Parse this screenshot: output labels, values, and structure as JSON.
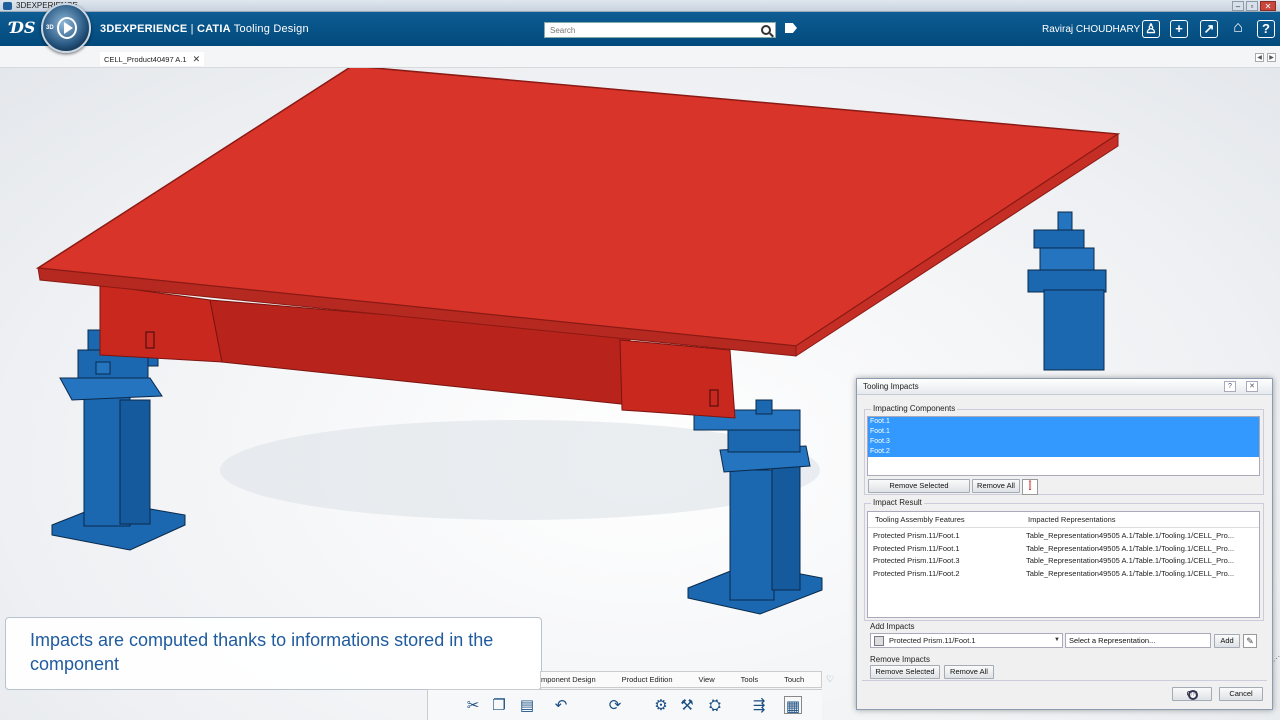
{
  "os_window": {
    "title": "3DEXPERIENCE",
    "controls": [
      "–",
      "▫",
      "✕"
    ]
  },
  "app": {
    "brand": "3DEXPERIENCE",
    "separator": " | ",
    "product": "CATIA",
    "app_name": " Tooling Design",
    "compass_label": "3D",
    "search_placeholder": "Search",
    "user_name": "Raviraj CHOUDHARY",
    "header_buttons": [
      "person-icon",
      "plus-icon",
      "share-icon",
      "home-icon",
      "help-icon"
    ]
  },
  "tabs": {
    "document": "CELL_Product40497 A.1",
    "close_glyph": "✕",
    "nav_left": "◀",
    "nav_right": "▶"
  },
  "caption": {
    "text": "Impacts are computed thanks to informations stored in the component"
  },
  "action_bar": {
    "tabs": [
      "mponent Design",
      "Product Edition",
      "View",
      "Tools",
      "Touch"
    ],
    "more_glyph": "♡",
    "tools": [
      "scissors-icon",
      "copy-icon",
      "paste-icon",
      "undo-icon",
      "update-icon",
      "assembly-icon",
      "tooling-icon",
      "impact-icon",
      "move-icon",
      "table-icon"
    ]
  },
  "dialog": {
    "title": "Tooling Impacts",
    "help_glyph": "?",
    "close_glyph": "✕",
    "impacting_components": {
      "title": "Impacting Components",
      "items": [
        "Foot.1",
        "Foot.1",
        "Foot.3",
        "Foot.2"
      ],
      "remove_selected": "Remove Selected",
      "remove_all": "Remove All"
    },
    "impact_result": {
      "title": "Impact Result",
      "columns": [
        "Tooling Assembly Features",
        "Impacted Representations"
      ],
      "rows": [
        {
          "feature": "Protected Prism.11/Foot.1",
          "representation": "Table_Representation49505 A.1/Table.1/Tooling.1/CELL_Pro..."
        },
        {
          "feature": "Protected Prism.11/Foot.1",
          "representation": "Table_Representation49505 A.1/Table.1/Tooling.1/CELL_Pro..."
        },
        {
          "feature": "Protected Prism.11/Foot.3",
          "representation": "Table_Representation49505 A.1/Table.1/Tooling.1/CELL_Pro..."
        },
        {
          "feature": "Protected Prism.11/Foot.2",
          "representation": "Table_Representation49505 A.1/Table.1/Tooling.1/CELL_Pro..."
        }
      ]
    },
    "add_impacts": {
      "title": "Add Impacts",
      "feature_value": "Protected Prism.11/Foot.1",
      "representation_value": "Select a Representation...",
      "add_button": "Add"
    },
    "remove_impacts": {
      "title": "Remove Impacts",
      "remove_selected": "Remove Selected",
      "remove_all": "Remove All"
    },
    "ok_button": "OK",
    "cancel_button": "Cancel"
  },
  "colors": {
    "header_blue": "#024a7c",
    "table_red": "#d9342a",
    "foot_blue": "#1b67b0",
    "selection_blue": "#3399ff",
    "caption_text": "#1f5b9e"
  }
}
